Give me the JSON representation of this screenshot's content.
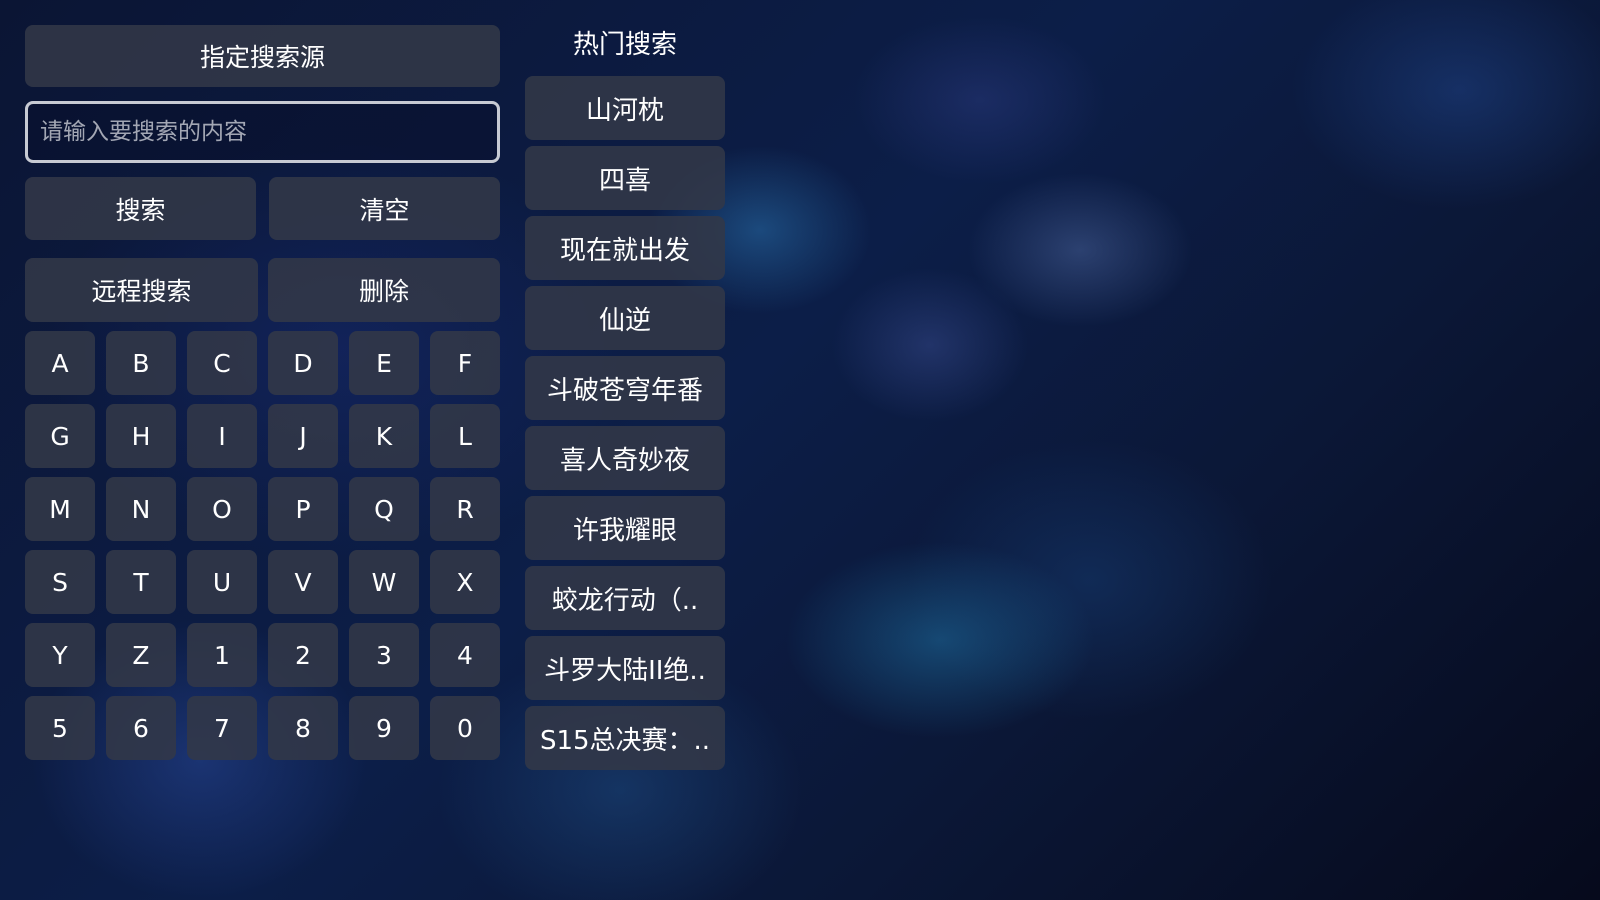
{
  "search_panel": {
    "source_button_label": "指定搜索源",
    "input_placeholder": "请输入要搜索的内容",
    "input_value": "",
    "search_button_label": "搜索",
    "clear_button_label": "清空",
    "remote_search_button_label": "远程搜索",
    "delete_button_label": "删除"
  },
  "keyboard": {
    "rows": [
      [
        "A",
        "B",
        "C",
        "D",
        "E",
        "F"
      ],
      [
        "G",
        "H",
        "I",
        "J",
        "K",
        "L"
      ],
      [
        "M",
        "N",
        "O",
        "P",
        "Q",
        "R"
      ],
      [
        "S",
        "T",
        "U",
        "V",
        "W",
        "X"
      ],
      [
        "Y",
        "Z",
        "1",
        "2",
        "3",
        "4"
      ],
      [
        "5",
        "6",
        "7",
        "8",
        "9",
        "0"
      ]
    ]
  },
  "hot_search": {
    "title": "热门搜索",
    "items": [
      "山河枕",
      "四喜",
      "现在就出发",
      "仙逆",
      "斗破苍穹年番",
      "喜人奇妙夜",
      "许我耀眼",
      "蛟龙行动（..",
      "斗罗大陆II绝..",
      "S15总决赛：.."
    ]
  }
}
